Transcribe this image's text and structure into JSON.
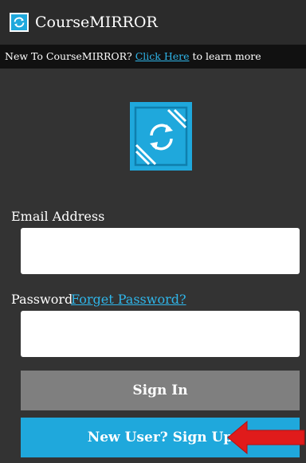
{
  "header": {
    "app_title": "CourseMIRROR",
    "icon": "sync-icon"
  },
  "info_bar": {
    "prefix": "New To CourseMIRROR?",
    "link": "Click Here",
    "suffix": "to learn more"
  },
  "logo": {
    "icon": "sync-icon"
  },
  "form": {
    "email_label": "Email Address",
    "email_value": "",
    "email_placeholder": "",
    "password_label": "Password",
    "password_value": "",
    "password_placeholder": "",
    "forgot_link": "Forget Password?"
  },
  "buttons": {
    "sign_in": "Sign In",
    "sign_up": "New User? Sign Up"
  },
  "annotation": {
    "icon": "red-arrow-icon"
  },
  "colors": {
    "background": "#333333",
    "title_bar": "#2b2b2b",
    "info_bar": "#111111",
    "accent": "#1fa8dc",
    "link": "#2fb6ea",
    "sign_in_button": "#7f7f7f",
    "arrow": "#e01b1b"
  }
}
